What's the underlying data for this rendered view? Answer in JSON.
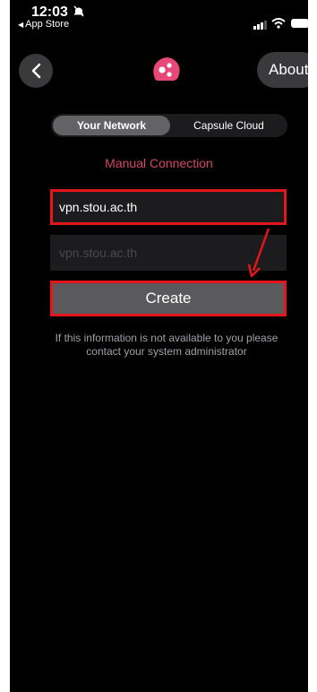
{
  "status": {
    "time": "12:03",
    "back_app": "App Store"
  },
  "nav": {
    "about_label": "About"
  },
  "tabs": [
    {
      "label": "Your Network",
      "active": true
    },
    {
      "label": "Capsule Cloud",
      "active": false
    }
  ],
  "form": {
    "section_title": "Manual Connection",
    "host_value": "vpn.stou.ac.th",
    "second_placeholder": "vpn.stou.ac.th",
    "create_label": "Create",
    "info_text": "If this information is not available to you please contact your system administrator"
  },
  "colors": {
    "accent": "#d5466b",
    "highlight": "#e4161b"
  }
}
